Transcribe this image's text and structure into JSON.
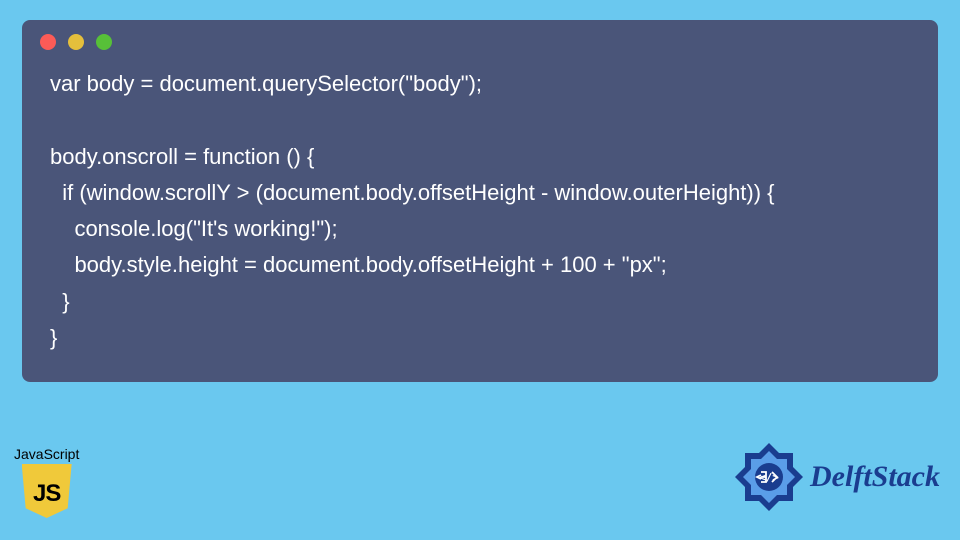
{
  "colors": {
    "background": "#6ac8ef",
    "codeWindow": "#4a5579",
    "dotRed": "#fc5b57",
    "dotYellow": "#e5bf3c",
    "dotGreen": "#57c038",
    "jsYellow": "#f0c93a",
    "delftBlue": "#1a3d8f"
  },
  "code": "var body = document.querySelector(\"body\");\n\nbody.onscroll = function () {\n  if (window.scrollY > (document.body.offsetHeight - window.outerHeight)) {\n    console.log(\"It's working!\");\n    body.style.height = document.body.offsetHeight + 100 + \"px\";\n  }\n}",
  "jsBadge": {
    "label": "JavaScript",
    "shieldText": "JS"
  },
  "delftBadge": {
    "text": "DelftStack"
  }
}
